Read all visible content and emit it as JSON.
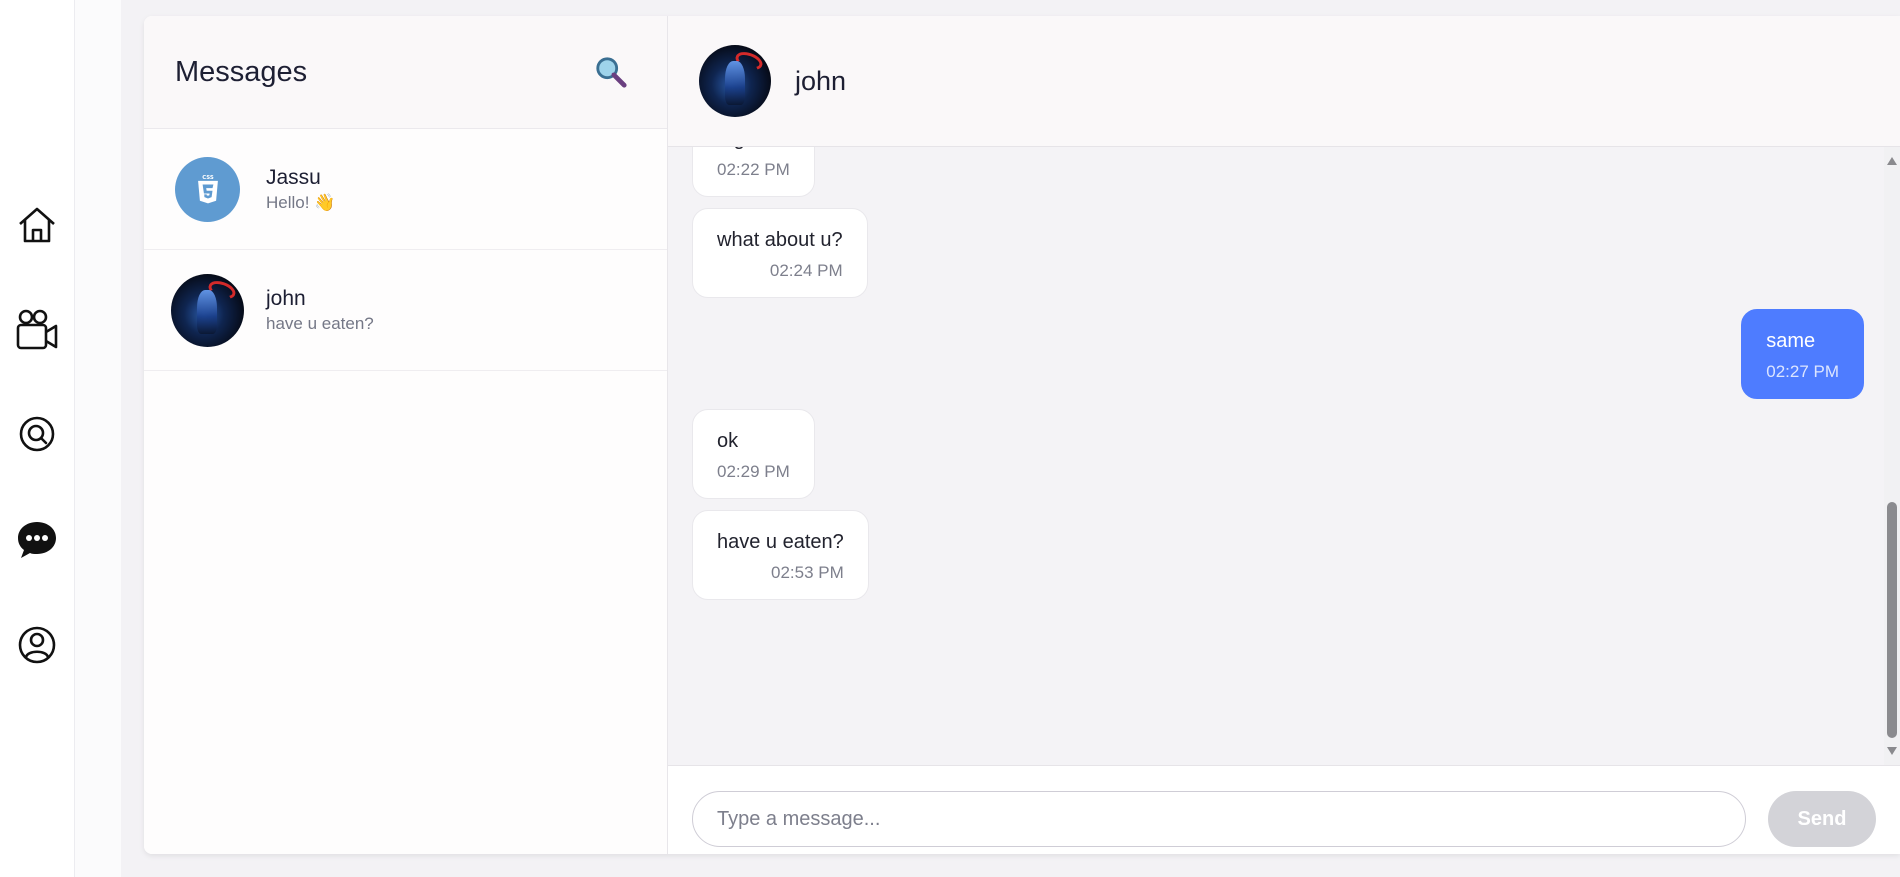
{
  "nav": {
    "items": [
      {
        "icon": "home-icon"
      },
      {
        "icon": "video-camera-icon"
      },
      {
        "icon": "search-icon"
      },
      {
        "icon": "chat-bubble-icon"
      },
      {
        "icon": "user-profile-icon"
      }
    ]
  },
  "sidebar": {
    "title": "Messages",
    "search_icon": "magnifier-icon",
    "conversations": [
      {
        "name": "Jassu",
        "preview": "Hello! 👋",
        "avatar": "css3-logo-avatar"
      },
      {
        "name": "john",
        "preview": "have u eaten?",
        "avatar": "john-avatar"
      }
    ]
  },
  "chat": {
    "contact_name": "john",
    "messages": [
      {
        "text": "ntg",
        "time": "02:22 PM",
        "direction": "incoming"
      },
      {
        "text": "what about u?",
        "time": "02:24 PM",
        "direction": "incoming"
      },
      {
        "text": "same",
        "time": "02:27 PM",
        "direction": "outgoing"
      },
      {
        "text": "ok",
        "time": "02:29 PM",
        "direction": "incoming"
      },
      {
        "text": "have u eaten?",
        "time": "02:53 PM",
        "direction": "incoming"
      }
    ],
    "colors": {
      "outgoing_bubble": "#4e7cff",
      "incoming_bubble": "#ffffff"
    }
  },
  "composer": {
    "placeholder": "Type a message...",
    "value": "",
    "send_label": "Send"
  }
}
